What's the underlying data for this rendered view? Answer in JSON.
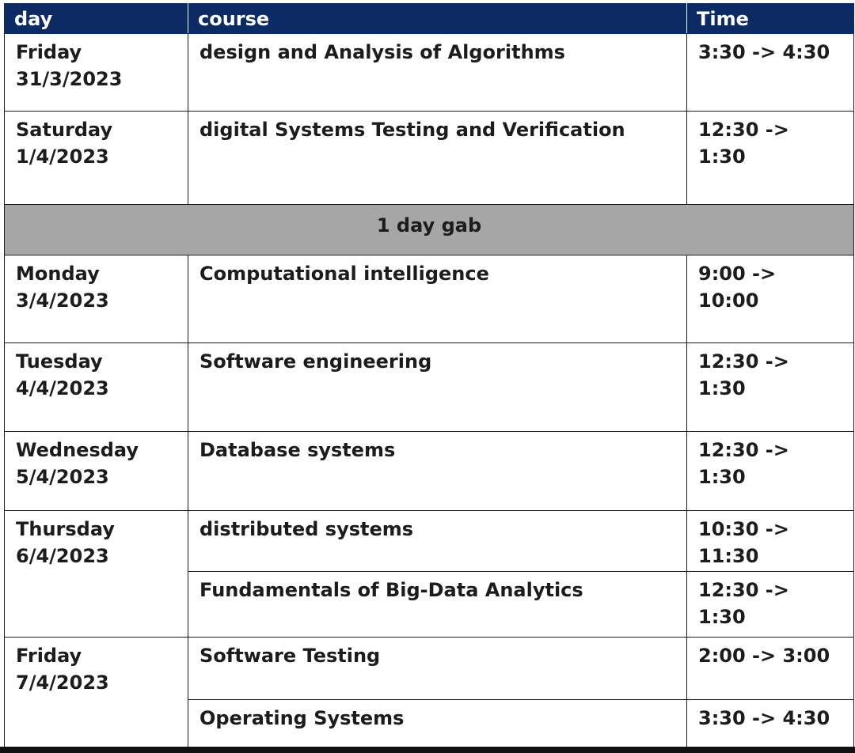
{
  "header": {
    "day": "day",
    "course": "course",
    "time": "Time"
  },
  "rows": [
    {
      "day": "Friday",
      "date": "31/3/2023",
      "courses": [
        {
          "course": "design and Analysis of Algorithms",
          "time": "3:30 -> 4:30"
        }
      ]
    },
    {
      "day": "Saturday",
      "date": "1/4/2023",
      "courses": [
        {
          "course": "digital Systems Testing and Verification",
          "time": "12:30 -> 1:30"
        }
      ]
    },
    {
      "gap": "1 day gab"
    },
    {
      "day": "Monday",
      "date": "3/4/2023",
      "courses": [
        {
          "course": "Computational intelligence",
          "time": "9:00 -> 10:00"
        }
      ]
    },
    {
      "day": "Tuesday",
      "date": "4/4/2023",
      "courses": [
        {
          "course": "Software engineering",
          "time": "12:30 -> 1:30"
        }
      ]
    },
    {
      "day": "Wednesday",
      "date": "5/4/2023",
      "courses": [
        {
          "course": "Database systems",
          "time": "12:30 -> 1:30"
        }
      ]
    },
    {
      "day": "Thursday",
      "date": "6/4/2023",
      "courses": [
        {
          "course": "distributed systems",
          "time": "10:30 -> 11:30"
        },
        {
          "course": "Fundamentals of Big-Data Analytics",
          "time": "12:30 -> 1:30"
        }
      ]
    },
    {
      "day": "Friday",
      "date": "7/4/2023",
      "courses": [
        {
          "course": "Software Testing",
          "time": "2:00 -> 3:00"
        },
        {
          "course": "Operating Systems",
          "time": "3:30 -> 4:30"
        }
      ]
    }
  ],
  "colors": {
    "header_bg": "#0c2a63",
    "header_text": "#ffffff",
    "gap_bg": "#a6a6a6",
    "border": "#1a1a1a"
  }
}
